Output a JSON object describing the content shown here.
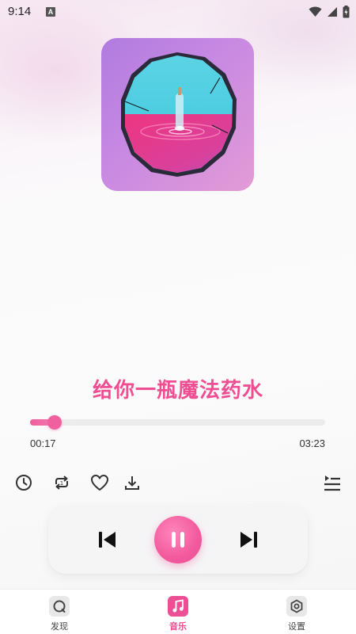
{
  "status_bar": {
    "time": "9:14",
    "indicator": "A",
    "icons": [
      "wifi-icon",
      "signal-icon",
      "battery-charging-icon"
    ]
  },
  "player": {
    "song_title": "给你一瓶魔法药水",
    "elapsed": "00:17",
    "total": "03:23",
    "progress_percent": 8.4
  },
  "actions": {
    "icons": [
      "timer-icon",
      "repeat-icon",
      "heart-icon",
      "download-icon",
      "playlist-icon"
    ]
  },
  "controls": {
    "icons": [
      "previous-icon",
      "pause-icon",
      "next-icon"
    ]
  },
  "bottom_nav": {
    "items": [
      {
        "label": "发现",
        "icon": "discover-icon",
        "active": false
      },
      {
        "label": "音乐",
        "icon": "music-note-icon",
        "active": true
      },
      {
        "label": "设置",
        "icon": "settings-icon",
        "active": false
      }
    ]
  },
  "colors": {
    "accent": "#ef4f92",
    "track": "#ececec"
  }
}
